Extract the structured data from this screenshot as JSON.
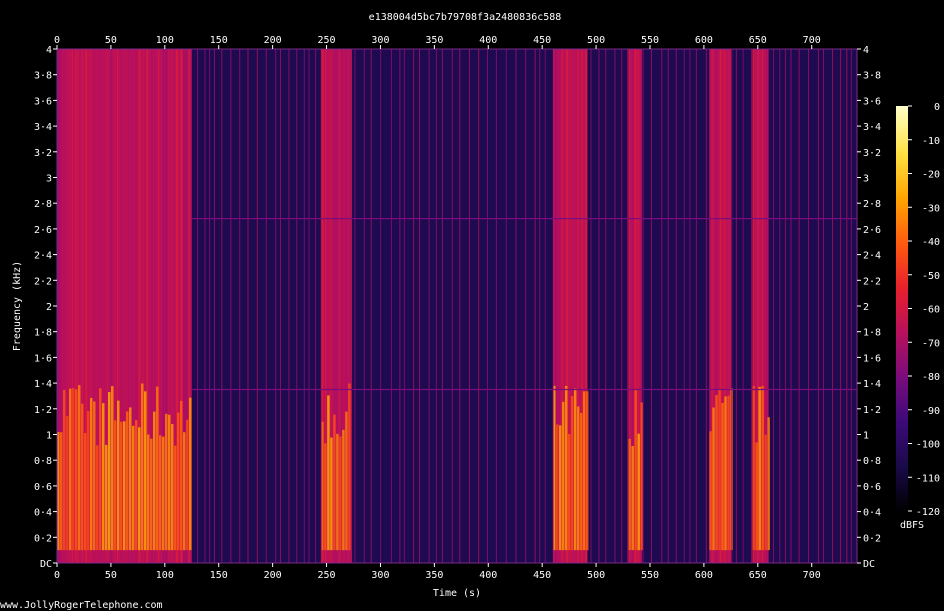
{
  "chart_data": {
    "type": "heatmap",
    "title": "e138004d5bc7b79708f3a2480836c588",
    "xlabel": "Time (s)",
    "ylabel": "Frequency (kHz)",
    "xlim": [
      0,
      742
    ],
    "ylim": [
      0,
      4
    ],
    "x_ticks": [
      "0",
      "50",
      "100",
      "150",
      "200",
      "250",
      "300",
      "350",
      "400",
      "450",
      "500",
      "550",
      "600",
      "650",
      "700"
    ],
    "x_tick_values": [
      0,
      50,
      100,
      150,
      200,
      250,
      300,
      350,
      400,
      450,
      500,
      550,
      600,
      650,
      700
    ],
    "y_ticks": [
      "DC",
      "0·2",
      "0·4",
      "0·6",
      "0·8",
      "1",
      "1·2",
      "1·4",
      "1·6",
      "1·8",
      "2",
      "2·2",
      "2·4",
      "2·6",
      "2·8",
      "3",
      "3·2",
      "3·4",
      "3·6",
      "3·8",
      "4"
    ],
    "y_tick_values": [
      0,
      0.2,
      0.4,
      0.6,
      0.8,
      1,
      1.2,
      1.4,
      1.6,
      1.8,
      2,
      2.2,
      2.4,
      2.6,
      2.8,
      3,
      3.2,
      3.4,
      3.6,
      3.8,
      4
    ],
    "colorbar": {
      "label": "dBFS",
      "ticks": [
        "0",
        "-10",
        "-20",
        "-30",
        "-40",
        "-50",
        "-60",
        "-70",
        "-80",
        "-90",
        "-100",
        "-110",
        "-120"
      ],
      "tick_values": [
        0,
        -10,
        -20,
        -30,
        -40,
        -50,
        -60,
        -70,
        -80,
        -90,
        -100,
        -110,
        -120
      ],
      "range": [
        -120,
        0
      ],
      "colors": [
        "#000000",
        "#1a0a4a",
        "#3c0a78",
        "#7a0c7c",
        "#b8105c",
        "#e8202c",
        "#ff5a10",
        "#ffa400",
        "#ffe040",
        "#ffffc8"
      ]
    },
    "active_segments_s": [
      [
        0,
        125
      ],
      [
        245,
        272
      ],
      [
        460,
        492
      ],
      [
        530,
        542
      ],
      [
        605,
        625
      ],
      [
        645,
        660
      ]
    ],
    "sparse_region_level_dbfs": -105,
    "active_region_level_dbfs": -60,
    "low_freq_peak_level_dbfs": -25,
    "horizontal_tone_lines_khz": [
      1.35,
      2.68
    ]
  },
  "footer": {
    "credit": "www.JollyRogerTelephone.com"
  }
}
